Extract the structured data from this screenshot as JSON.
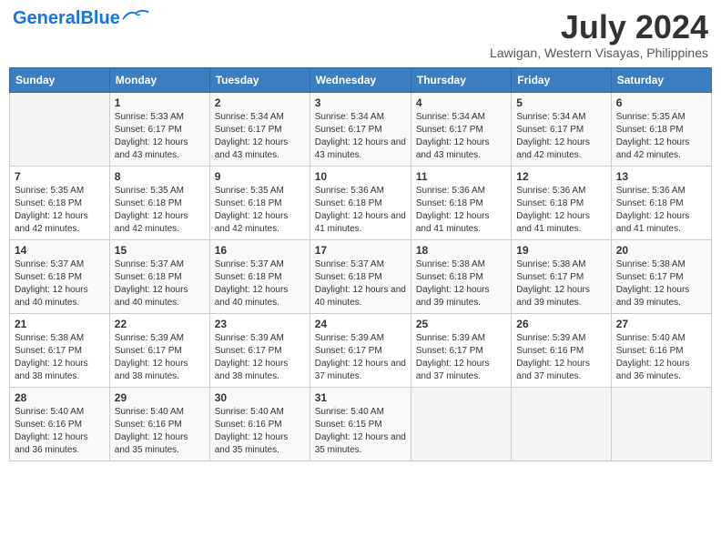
{
  "header": {
    "logo_general": "General",
    "logo_blue": "Blue",
    "month_year": "July 2024",
    "location": "Lawigan, Western Visayas, Philippines"
  },
  "weekdays": [
    "Sunday",
    "Monday",
    "Tuesday",
    "Wednesday",
    "Thursday",
    "Friday",
    "Saturday"
  ],
  "weeks": [
    [
      {
        "day": "",
        "sunrise": "",
        "sunset": "",
        "daylight": ""
      },
      {
        "day": "1",
        "sunrise": "Sunrise: 5:33 AM",
        "sunset": "Sunset: 6:17 PM",
        "daylight": "Daylight: 12 hours and 43 minutes."
      },
      {
        "day": "2",
        "sunrise": "Sunrise: 5:34 AM",
        "sunset": "Sunset: 6:17 PM",
        "daylight": "Daylight: 12 hours and 43 minutes."
      },
      {
        "day": "3",
        "sunrise": "Sunrise: 5:34 AM",
        "sunset": "Sunset: 6:17 PM",
        "daylight": "Daylight: 12 hours and 43 minutes."
      },
      {
        "day": "4",
        "sunrise": "Sunrise: 5:34 AM",
        "sunset": "Sunset: 6:17 PM",
        "daylight": "Daylight: 12 hours and 43 minutes."
      },
      {
        "day": "5",
        "sunrise": "Sunrise: 5:34 AM",
        "sunset": "Sunset: 6:17 PM",
        "daylight": "Daylight: 12 hours and 42 minutes."
      },
      {
        "day": "6",
        "sunrise": "Sunrise: 5:35 AM",
        "sunset": "Sunset: 6:18 PM",
        "daylight": "Daylight: 12 hours and 42 minutes."
      }
    ],
    [
      {
        "day": "7",
        "sunrise": "Sunrise: 5:35 AM",
        "sunset": "Sunset: 6:18 PM",
        "daylight": "Daylight: 12 hours and 42 minutes."
      },
      {
        "day": "8",
        "sunrise": "Sunrise: 5:35 AM",
        "sunset": "Sunset: 6:18 PM",
        "daylight": "Daylight: 12 hours and 42 minutes."
      },
      {
        "day": "9",
        "sunrise": "Sunrise: 5:35 AM",
        "sunset": "Sunset: 6:18 PM",
        "daylight": "Daylight: 12 hours and 42 minutes."
      },
      {
        "day": "10",
        "sunrise": "Sunrise: 5:36 AM",
        "sunset": "Sunset: 6:18 PM",
        "daylight": "Daylight: 12 hours and 41 minutes."
      },
      {
        "day": "11",
        "sunrise": "Sunrise: 5:36 AM",
        "sunset": "Sunset: 6:18 PM",
        "daylight": "Daylight: 12 hours and 41 minutes."
      },
      {
        "day": "12",
        "sunrise": "Sunrise: 5:36 AM",
        "sunset": "Sunset: 6:18 PM",
        "daylight": "Daylight: 12 hours and 41 minutes."
      },
      {
        "day": "13",
        "sunrise": "Sunrise: 5:36 AM",
        "sunset": "Sunset: 6:18 PM",
        "daylight": "Daylight: 12 hours and 41 minutes."
      }
    ],
    [
      {
        "day": "14",
        "sunrise": "Sunrise: 5:37 AM",
        "sunset": "Sunset: 6:18 PM",
        "daylight": "Daylight: 12 hours and 40 minutes."
      },
      {
        "day": "15",
        "sunrise": "Sunrise: 5:37 AM",
        "sunset": "Sunset: 6:18 PM",
        "daylight": "Daylight: 12 hours and 40 minutes."
      },
      {
        "day": "16",
        "sunrise": "Sunrise: 5:37 AM",
        "sunset": "Sunset: 6:18 PM",
        "daylight": "Daylight: 12 hours and 40 minutes."
      },
      {
        "day": "17",
        "sunrise": "Sunrise: 5:37 AM",
        "sunset": "Sunset: 6:18 PM",
        "daylight": "Daylight: 12 hours and 40 minutes."
      },
      {
        "day": "18",
        "sunrise": "Sunrise: 5:38 AM",
        "sunset": "Sunset: 6:18 PM",
        "daylight": "Daylight: 12 hours and 39 minutes."
      },
      {
        "day": "19",
        "sunrise": "Sunrise: 5:38 AM",
        "sunset": "Sunset: 6:17 PM",
        "daylight": "Daylight: 12 hours and 39 minutes."
      },
      {
        "day": "20",
        "sunrise": "Sunrise: 5:38 AM",
        "sunset": "Sunset: 6:17 PM",
        "daylight": "Daylight: 12 hours and 39 minutes."
      }
    ],
    [
      {
        "day": "21",
        "sunrise": "Sunrise: 5:38 AM",
        "sunset": "Sunset: 6:17 PM",
        "daylight": "Daylight: 12 hours and 38 minutes."
      },
      {
        "day": "22",
        "sunrise": "Sunrise: 5:39 AM",
        "sunset": "Sunset: 6:17 PM",
        "daylight": "Daylight: 12 hours and 38 minutes."
      },
      {
        "day": "23",
        "sunrise": "Sunrise: 5:39 AM",
        "sunset": "Sunset: 6:17 PM",
        "daylight": "Daylight: 12 hours and 38 minutes."
      },
      {
        "day": "24",
        "sunrise": "Sunrise: 5:39 AM",
        "sunset": "Sunset: 6:17 PM",
        "daylight": "Daylight: 12 hours and 37 minutes."
      },
      {
        "day": "25",
        "sunrise": "Sunrise: 5:39 AM",
        "sunset": "Sunset: 6:17 PM",
        "daylight": "Daylight: 12 hours and 37 minutes."
      },
      {
        "day": "26",
        "sunrise": "Sunrise: 5:39 AM",
        "sunset": "Sunset: 6:16 PM",
        "daylight": "Daylight: 12 hours and 37 minutes."
      },
      {
        "day": "27",
        "sunrise": "Sunrise: 5:40 AM",
        "sunset": "Sunset: 6:16 PM",
        "daylight": "Daylight: 12 hours and 36 minutes."
      }
    ],
    [
      {
        "day": "28",
        "sunrise": "Sunrise: 5:40 AM",
        "sunset": "Sunset: 6:16 PM",
        "daylight": "Daylight: 12 hours and 36 minutes."
      },
      {
        "day": "29",
        "sunrise": "Sunrise: 5:40 AM",
        "sunset": "Sunset: 6:16 PM",
        "daylight": "Daylight: 12 hours and 35 minutes."
      },
      {
        "day": "30",
        "sunrise": "Sunrise: 5:40 AM",
        "sunset": "Sunset: 6:16 PM",
        "daylight": "Daylight: 12 hours and 35 minutes."
      },
      {
        "day": "31",
        "sunrise": "Sunrise: 5:40 AM",
        "sunset": "Sunset: 6:15 PM",
        "daylight": "Daylight: 12 hours and 35 minutes."
      },
      {
        "day": "",
        "sunrise": "",
        "sunset": "",
        "daylight": ""
      },
      {
        "day": "",
        "sunrise": "",
        "sunset": "",
        "daylight": ""
      },
      {
        "day": "",
        "sunrise": "",
        "sunset": "",
        "daylight": ""
      }
    ]
  ]
}
